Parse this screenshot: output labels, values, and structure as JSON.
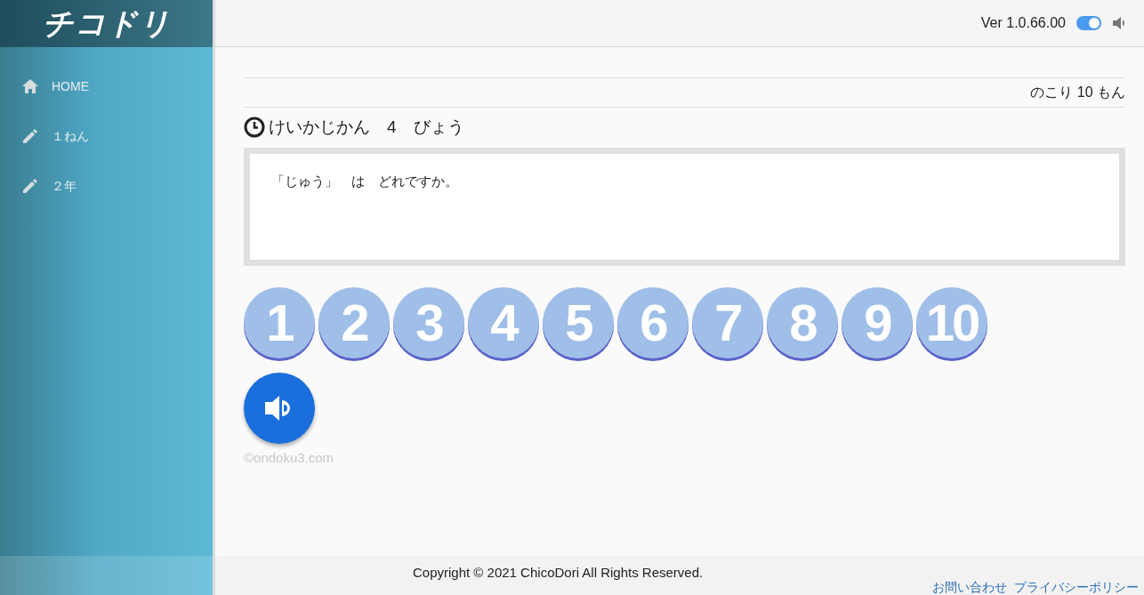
{
  "logo": "チコドリ",
  "sidebar": {
    "items": [
      {
        "kind": "home",
        "label": "HOME"
      },
      {
        "kind": "pencil",
        "label": "１ねん"
      },
      {
        "kind": "pencil",
        "label": "２年"
      }
    ]
  },
  "header": {
    "version": "Ver 1.0.66.00",
    "sound_toggle": {
      "on": true
    }
  },
  "remaining": "のこり 10 もん",
  "elapsed": "けいかじかん　4　びょう",
  "question": "「じゅう」　は　どれですか。",
  "answers": [
    "1",
    "2",
    "3",
    "4",
    "5",
    "6",
    "7",
    "8",
    "9",
    "10"
  ],
  "credit": "©ondoku3.com",
  "footer": {
    "copyright": "Copyright ©  2021 ChicoDori All Rights Reserved.",
    "links": [
      "お問い合わせ",
      "プライバシーポリシー"
    ]
  }
}
